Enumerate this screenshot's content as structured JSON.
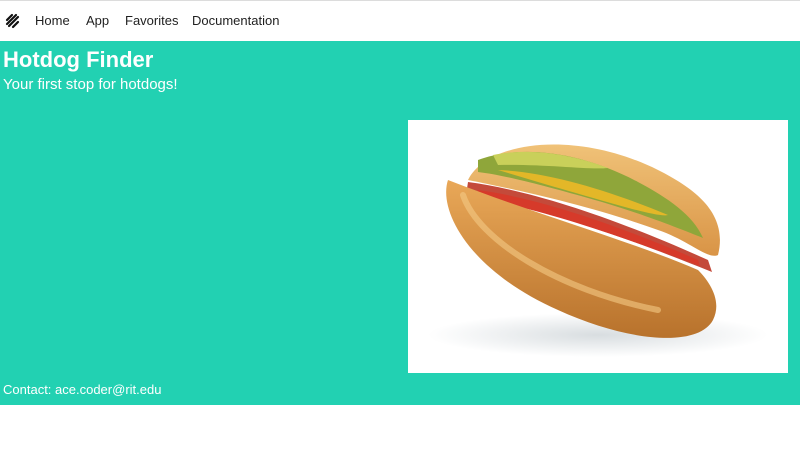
{
  "nav": {
    "logo_icon": "bulma-logo-icon",
    "links": [
      "Home",
      "App",
      "Favorites",
      "Documentation"
    ]
  },
  "hero": {
    "title": "Hotdog Finder",
    "subtitle": "Your first stop for hotdogs!",
    "image_icon": "hotdog-image",
    "contact": "Contact: ace.coder@rit.edu",
    "background_color": "#22d1b2"
  }
}
